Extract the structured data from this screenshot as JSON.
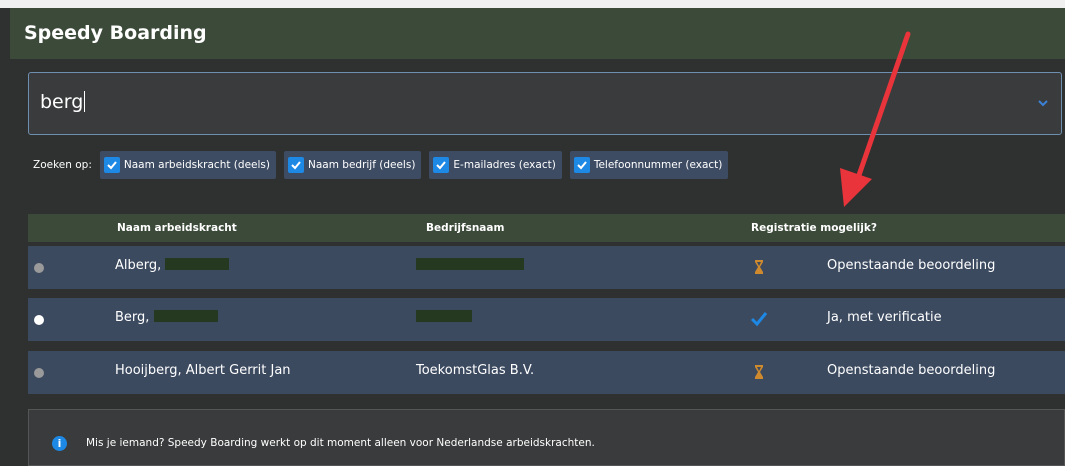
{
  "app": {
    "title": "Speedy Boarding"
  },
  "search": {
    "value": "berg"
  },
  "filters": {
    "label": "Zoeken op:",
    "options": [
      {
        "label": "Naam arbeidskracht (deels)",
        "checked": true
      },
      {
        "label": "Naam bedrijf (deels)",
        "checked": true
      },
      {
        "label": "E-mailadres (exact)",
        "checked": true
      },
      {
        "label": "Telefoonnummer (exact)",
        "checked": true
      }
    ]
  },
  "table": {
    "columns": [
      "Naam arbeidskracht",
      "Bedrijfsnaam",
      "Registratie mogelijk?"
    ],
    "rows": [
      {
        "name": "Alberg,",
        "company": "",
        "status_icon": "hourglass-icon",
        "status": "Openstaande beoordeling"
      },
      {
        "name": "Berg,",
        "company": "",
        "status_icon": "check-icon",
        "status": "Ja, met verificatie"
      },
      {
        "name": "Hooijberg, Albert Gerrit Jan",
        "company": "ToekomstGlas B.V.",
        "status_icon": "hourglass-icon",
        "status": "Openstaande beoordeling"
      }
    ]
  },
  "info": {
    "icon": "i",
    "text": "Mis je iemand? Speedy Boarding werkt op dit moment alleen voor Nederlandse arbeidskrachten."
  },
  "colors": {
    "header": "#3b4a39",
    "row": "#3c4a60",
    "accent": "#1e88e5",
    "pending": "#d08a2e",
    "annotation": "#e8343a"
  }
}
